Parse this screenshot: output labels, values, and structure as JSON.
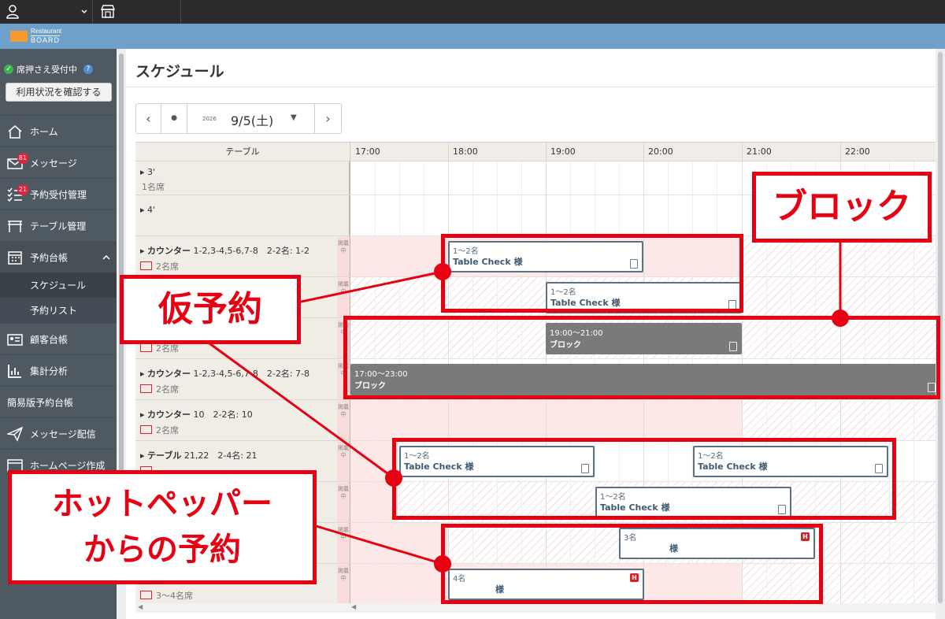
{
  "topbar": {
    "user_icon": "user-icon",
    "dropdown_icon": "chevron-down-icon",
    "store_icon": "store-icon"
  },
  "brand": {
    "line1": "Restaurant",
    "line2": "BOARD"
  },
  "sidebar": {
    "status_label": "席押さえ受付中",
    "help_label": "?",
    "check_button": "利用状況を確認する",
    "items": [
      {
        "label": "ホーム",
        "icon": "home-icon"
      },
      {
        "label": "メッセージ",
        "icon": "mail-icon",
        "badge": "81"
      },
      {
        "label": "予約受付管理",
        "icon": "checklist-icon",
        "badge": "21"
      },
      {
        "label": "テーブル管理",
        "icon": "table-icon"
      },
      {
        "label": "予約台帳",
        "icon": "calendar-icon"
      },
      {
        "label": "スケジュール"
      },
      {
        "label": "予約リスト"
      },
      {
        "label": "顧客台帳",
        "icon": "id-card-icon"
      },
      {
        "label": "集計分析",
        "icon": "chart-icon"
      },
      {
        "label": "簡易版予約台帳"
      },
      {
        "label": "メッセージ配信",
        "icon": "send-icon"
      },
      {
        "label": "ホームページ作成",
        "icon": "web-icon"
      }
    ]
  },
  "main": {
    "title": "スケジュール",
    "date": {
      "prev": "‹",
      "today": "●",
      "year": "2026",
      "value": "9/5(土)",
      "caret": "▼",
      "next": "›"
    }
  },
  "schedule": {
    "table_header": "テーブル",
    "hours": [
      "17:00",
      "18:00",
      "19:00",
      "20:00",
      "21:00",
      "22:00"
    ],
    "keisai": "掲載中",
    "rows": [
      {
        "name": "3'",
        "seats": "1名席"
      },
      {
        "name": "4'",
        "seats": ""
      },
      {
        "name": "カウンター",
        "detail": " 1-2,3-4,5-6,7-8　2-2名: 1-2",
        "seats": "2名席"
      },
      {
        "name": "",
        "seats": ""
      },
      {
        "name": "",
        "seats": "2名席"
      },
      {
        "name": "カウンター",
        "detail": " 1-2,3-4,5-6,7-8　2-2名: 7-8",
        "seats": "2名席"
      },
      {
        "name": "カウンター",
        "detail": " 10　2-2名: 10",
        "seats": "2名席"
      },
      {
        "name": "テーブル",
        "detail": " 21,22　2-4名: 21",
        "seats": ""
      },
      {
        "name": "",
        "seats": ""
      },
      {
        "name": "",
        "seats": ""
      },
      {
        "name": "",
        "seats": "3〜4名席"
      }
    ],
    "reservations": [
      {
        "count": "1〜2名",
        "name": "Table Check 様"
      },
      {
        "count": "1〜2名",
        "name": "Table Check 様"
      },
      {
        "count": "1〜2名",
        "name": "Table Check 様"
      },
      {
        "count": "1〜2名",
        "name": "Table Check 様"
      },
      {
        "count": "1〜2名",
        "name": "Table Check 様"
      },
      {
        "count": "3名",
        "name": "様"
      },
      {
        "count": "4名",
        "name": "様"
      }
    ],
    "blocks": [
      {
        "time": "19:00〜21:00",
        "label": "ブロック"
      },
      {
        "time": "17:00〜23:00",
        "label": "ブロック"
      }
    ]
  },
  "annotations": {
    "block": "ブロック",
    "tentative": "仮予約",
    "hotpepper_line1": "ホットペッパー",
    "hotpepper_line2": "からの予約",
    "color": "#e60012"
  }
}
